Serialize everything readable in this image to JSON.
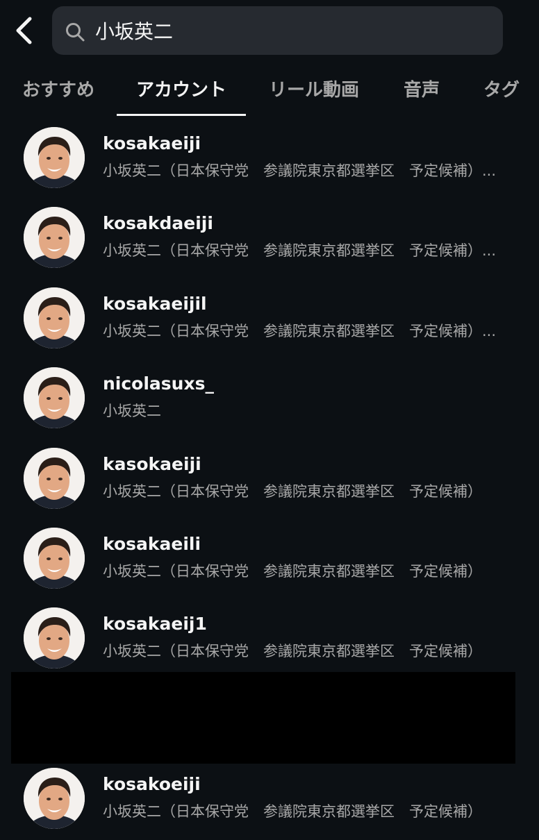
{
  "search": {
    "value": "小坂英二"
  },
  "tabs": [
    {
      "label": "おすすめ",
      "active": false
    },
    {
      "label": "アカウント",
      "active": true
    },
    {
      "label": "リール動画",
      "active": false
    },
    {
      "label": "音声",
      "active": false
    },
    {
      "label": "タグ",
      "active": false
    }
  ],
  "results": [
    {
      "username": "kosakaeiji",
      "full_name": "小坂英二（日本保守党　参議院東京都選挙区　予定候補）..."
    },
    {
      "username": "kosakdaeiji",
      "full_name": "小坂英二（日本保守党　参議院東京都選挙区　予定候補）..."
    },
    {
      "username": "kosakaeijil",
      "full_name": "小坂英二（日本保守党　参議院東京都選挙区　予定候補）..."
    },
    {
      "username": "nicolasuxs_",
      "full_name": "小坂英二"
    },
    {
      "username": "kasokaeiji",
      "full_name": "小坂英二（日本保守党　参議院東京都選挙区　予定候補）"
    },
    {
      "username": "kosakaeili",
      "full_name": "小坂英二（日本保守党　参議院東京都選挙区　予定候補）"
    },
    {
      "username": "kosakaeij1",
      "full_name": "小坂英二（日本保守党　参議院東京都選挙区　予定候補）"
    },
    {
      "username": "kosakoeiji",
      "full_name": "小坂英二（日本保守党　参議院東京都選挙区　予定候補）"
    }
  ],
  "icons": {
    "back": "chevron-left-icon",
    "search": "search-icon"
  },
  "colors": {
    "background": "#0c1014",
    "search_field": "#262a30",
    "text_primary": "#f5f5f5",
    "text_secondary": "#a8a8a8",
    "redaction": "#000000"
  }
}
